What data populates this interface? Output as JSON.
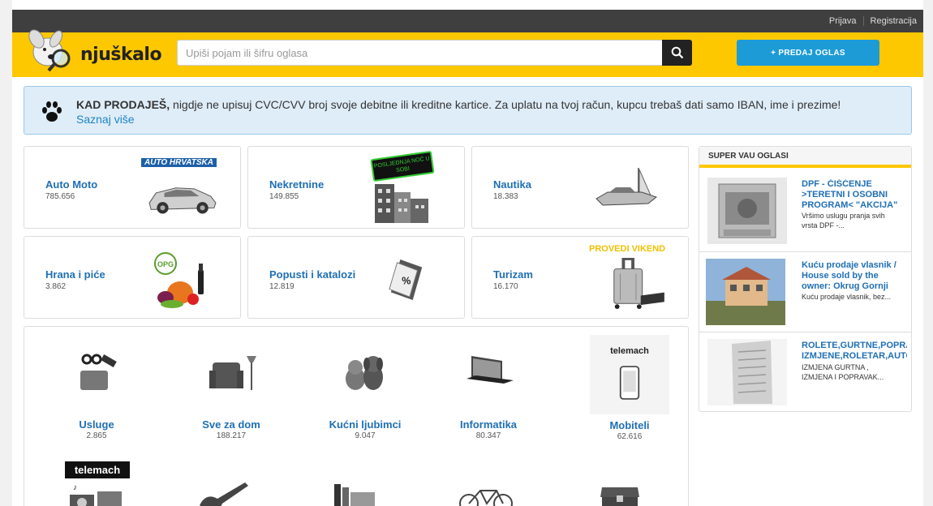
{
  "top_links": {
    "login": "Prijava",
    "register": "Registracija"
  },
  "header": {
    "logo_text": "njuškalo",
    "search_placeholder": "Upiši pojam ili šifru oglasa",
    "sell_button": "+ PREDAJ OGLAS",
    "accent": "#fdc800",
    "button_blue": "#1d9bd7"
  },
  "notice": {
    "bold": "KAD PRODAJEŠ,",
    "text": " nigdje ne upisuj CVC/CVV broj svoje debitne ili kreditne kartice. Za uplatu na tvoj račun, kupcu trebaš dati samo IBAN, ime i prezime!",
    "link": "Saznaj više"
  },
  "top_categories": [
    {
      "title": "Auto Moto",
      "count": "785.656",
      "badge": "AUTO HRVATSKA"
    },
    {
      "title": "Nekretnine",
      "count": "149.855",
      "badge": "POSLJEDNJA NOĆ U SOBI"
    },
    {
      "title": "Nautika",
      "count": "18.383"
    },
    {
      "title": "Hrana i piće",
      "count": "3.862",
      "badge": "OPG"
    },
    {
      "title": "Popusti i katalozi",
      "count": "12.819"
    },
    {
      "title": "Turizam",
      "count": "16.170",
      "badge": "PROVEDI VIKEND"
    }
  ],
  "grid_categories": [
    {
      "title": "Usluge",
      "count": "2.865"
    },
    {
      "title": "Sve za dom",
      "count": "188.217"
    },
    {
      "title": "Kućni ljubimci",
      "count": "9.047"
    },
    {
      "title": "Informatika",
      "count": "80.347"
    },
    {
      "title": "Mobiteli",
      "count": "62.616",
      "badge": "telemach"
    }
  ],
  "grid_row2_badge": "telemach",
  "sidebar": {
    "title": "SUPER VAU OGLASI",
    "items": [
      {
        "title": "DPF - ČIŠĆENJE",
        "title2": ">TERETNI I OSOBNI",
        "title3": "PROGRAM< \"AKCIJA\"",
        "desc": "Vršimo uslugu pranja svih",
        "desc2": "vrsta DPF -..."
      },
      {
        "title": "Kuću prodaje vlasnik /",
        "title2": "House sold by the",
        "title3": "owner: Okrug Gornji",
        "desc": "Kuću prodaje vlasnik, bez..."
      },
      {
        "title": "ROLETE,GURTNE,POPRAVCI",
        "title2": "IZMJENE,ROLETAR,AUTOMATIKA",
        "desc": "IZMJENA GURTNA ,",
        "desc2": "IZMJENA I POPRAVAK..."
      }
    ]
  }
}
